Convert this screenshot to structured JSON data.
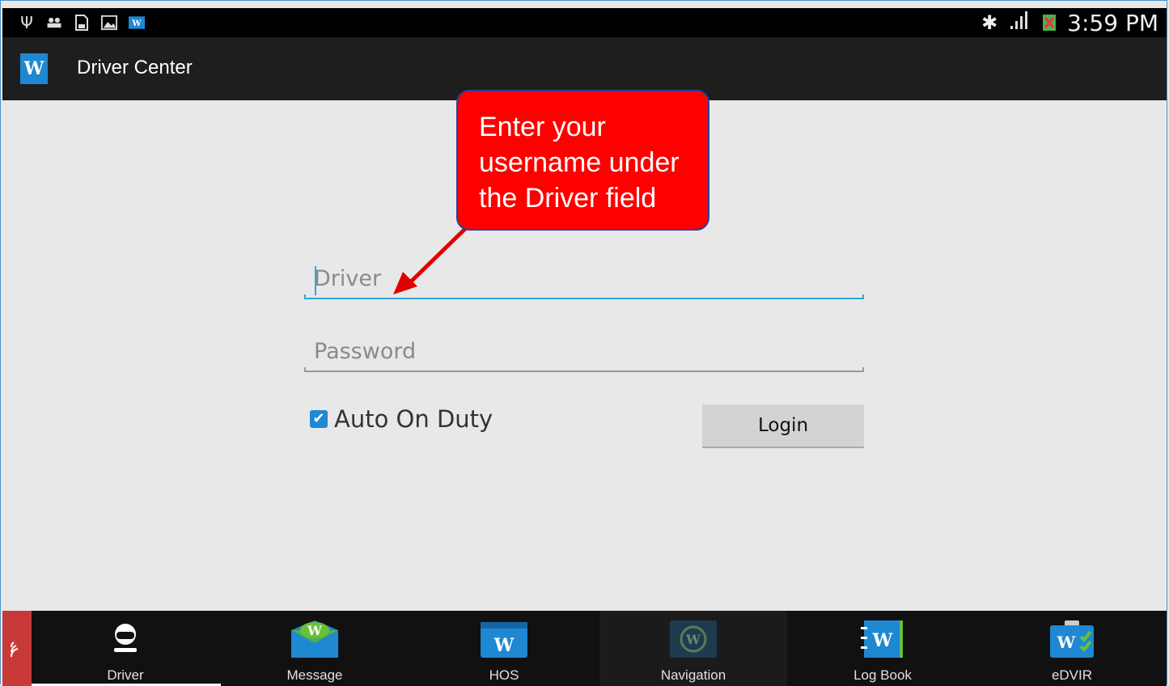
{
  "statusbar": {
    "time": "3:59 PM",
    "left_icons": [
      "usb-icon",
      "users-icon",
      "sd-card-icon",
      "gallery-icon",
      "w-app-icon"
    ],
    "right_icons": [
      "bluetooth-icon",
      "signal-icon",
      "battery-icon"
    ]
  },
  "appbar": {
    "logo": "W",
    "title": "Driver Center"
  },
  "form": {
    "driver_placeholder": "Driver",
    "password_placeholder": "Password",
    "auto_on_duty_label": "Auto On Duty",
    "auto_on_duty_checked": true,
    "login_label": "Login"
  },
  "callout": {
    "text": "Enter your username under the Driver field"
  },
  "bottom_nav": [
    {
      "label": "Driver",
      "icon": "driver-icon"
    },
    {
      "label": "Message",
      "icon": "message-icon"
    },
    {
      "label": "HOS",
      "icon": "hos-icon"
    },
    {
      "label": "Navigation",
      "icon": "navigation-icon"
    },
    {
      "label": "Log Book",
      "icon": "logbook-icon"
    },
    {
      "label": "eDVIR",
      "icon": "edvir-icon"
    }
  ],
  "colors": {
    "accent": "#1e88d2",
    "callout": "#ff0000",
    "focus_line": "#33a4dd"
  }
}
